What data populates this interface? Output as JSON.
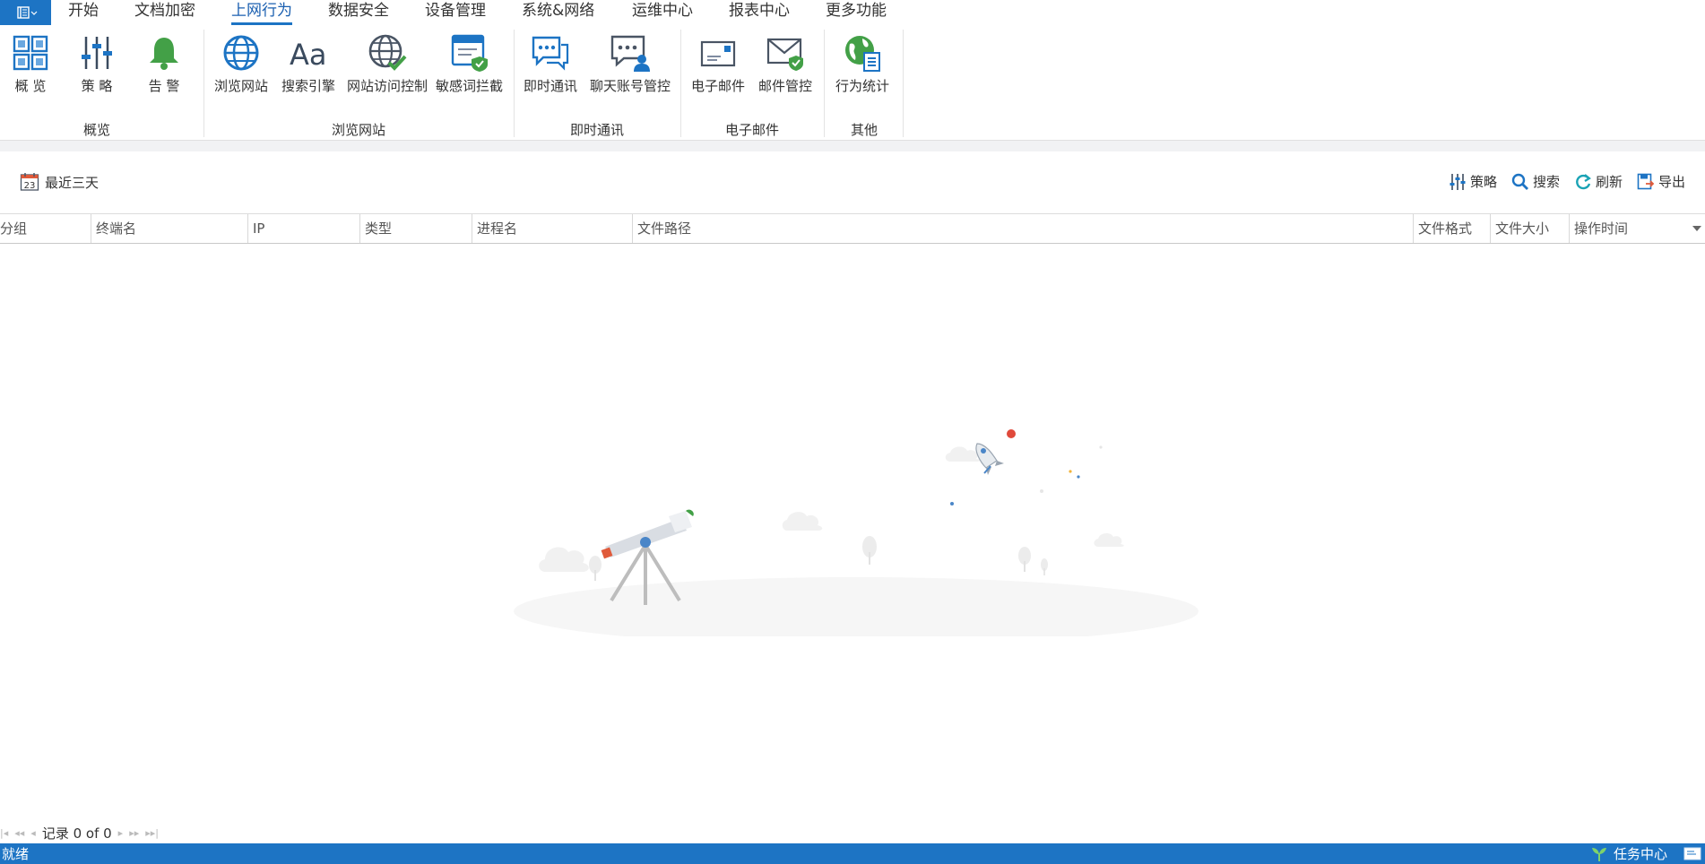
{
  "menubar": {
    "items": [
      "开始",
      "文档加密",
      "上网行为",
      "数据安全",
      "设备管理",
      "系统&网络",
      "运维中心",
      "报表中心",
      "更多功能"
    ],
    "active_index": 2
  },
  "ribbon": {
    "groups": [
      {
        "label": "概览",
        "buttons": [
          {
            "label": "概 览",
            "icon": "grid-icon"
          },
          {
            "label": "策 略",
            "icon": "sliders-icon"
          },
          {
            "label": "告 警",
            "icon": "bell-icon"
          }
        ]
      },
      {
        "label": "浏览网站",
        "buttons": [
          {
            "label": "浏览网站",
            "icon": "globe-icon"
          },
          {
            "label": "搜索引擎",
            "icon": "font-aa-icon"
          },
          {
            "label": "网站访问控制",
            "icon": "globe-check-icon"
          },
          {
            "label": "敏感词拦截",
            "icon": "browser-shield-icon"
          }
        ]
      },
      {
        "label": "即时通讯",
        "buttons": [
          {
            "label": "即时通讯",
            "icon": "chat-icon"
          },
          {
            "label": "聊天账号管控",
            "icon": "chat-user-icon"
          }
        ]
      },
      {
        "label": "电子邮件",
        "buttons": [
          {
            "label": "电子邮件",
            "icon": "envelope-icon"
          },
          {
            "label": "邮件管控",
            "icon": "envelope-shield-icon"
          }
        ]
      },
      {
        "label": "其他",
        "buttons": [
          {
            "label": "行为统计",
            "icon": "earth-report-icon"
          }
        ]
      }
    ]
  },
  "toolbar": {
    "date_filter": {
      "label": "最近三天",
      "calendar_day": "23"
    },
    "actions": [
      {
        "label": "策略",
        "icon": "sliders-icon"
      },
      {
        "label": "搜索",
        "icon": "search-icon"
      },
      {
        "label": "刷新",
        "icon": "refresh-icon"
      },
      {
        "label": "导出",
        "icon": "export-icon"
      }
    ]
  },
  "table": {
    "columns": [
      "分组",
      "终端名",
      "IP",
      "类型",
      "进程名",
      "文件路径",
      "文件格式",
      "文件大小",
      "操作时间"
    ],
    "rows": []
  },
  "pager": {
    "text": "记录 0 of 0"
  },
  "statusbar": {
    "status": "就绪",
    "task_center": "任务中心"
  },
  "colors": {
    "accent": "#1d74c4",
    "green": "#4caf50"
  }
}
